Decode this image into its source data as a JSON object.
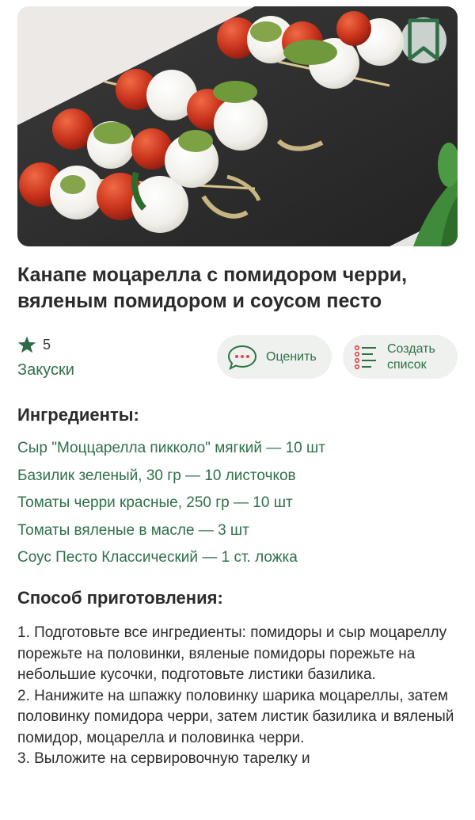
{
  "recipe": {
    "title": "Канапе моцарелла с помидором черри, вяленым помидором и соусом песто",
    "rating": "5",
    "category": "Закуски"
  },
  "actions": {
    "rate_label": "Оценить",
    "create_list_label": "Создать список"
  },
  "ingredients": {
    "heading": "Ингредиенты:",
    "items": [
      "Сыр \"Моццарелла пикколо\" мягкий — 10 шт",
      "Базилик зеленый, 30 гр — 10 листочков",
      "Томаты черри красные, 250 гр — 10 шт",
      "Томаты вяленые в масле — 3 шт",
      "Соус Песто Классический — 1 ст. ложка"
    ]
  },
  "method": {
    "heading": "Способ приготовления:",
    "steps": [
      "1. Подготовьте все ингредиенты: помидоры и сыр моцареллу порежьте на половинки, вяленые помидоры порежьте на небольшие кусочки, подготовьте листики базилика.",
      "2. Нанижите на шпажку половинку шарика моцареллы, затем половинку помидора черри, затем листик базилика и вяленый помидор, моцарелла и половинка черри.",
      "3. Выложите на сервировочную тарелку и"
    ]
  },
  "colors": {
    "accent": "#2e7048",
    "pill_bg": "#eef1ed",
    "text": "#2b2b2b"
  },
  "icons": {
    "bookmark": "bookmark-icon",
    "star": "star-icon",
    "rate": "chat-bubble-icon",
    "list": "list-icon"
  }
}
